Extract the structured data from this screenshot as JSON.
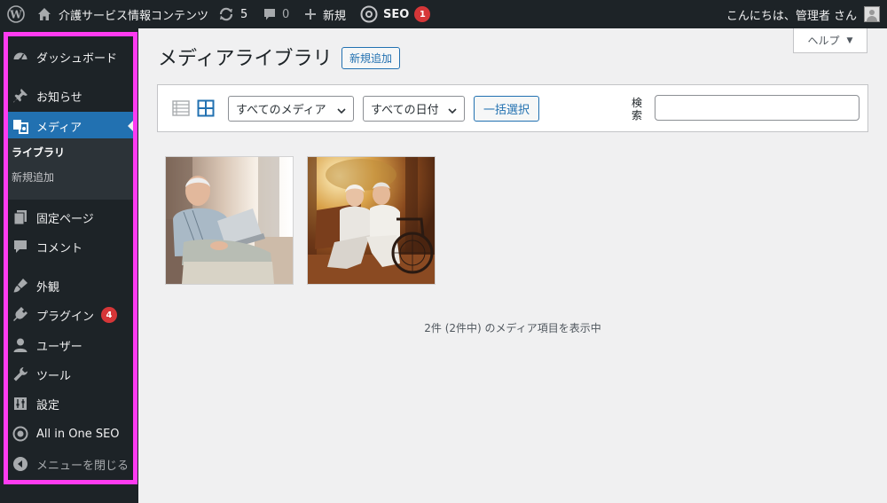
{
  "adminbar": {
    "site_name": "介護サービス情報コンテンツ",
    "updates_count": "5",
    "comments_count": "0",
    "new_label": "新規",
    "seo_label": "SEO",
    "seo_badge": "1",
    "greeting": "こんにちは、管理者 さん"
  },
  "sidebar": {
    "items": [
      {
        "label": "ダッシュボード",
        "icon": "dashboard-icon"
      },
      {
        "label": "お知らせ",
        "icon": "pin-icon"
      },
      {
        "label": "メディア",
        "icon": "media-icon"
      },
      {
        "label": "固定ページ",
        "icon": "page-icon"
      },
      {
        "label": "コメント",
        "icon": "comment-icon"
      },
      {
        "label": "外観",
        "icon": "appearance-icon"
      },
      {
        "label": "プラグイン",
        "icon": "plugin-icon",
        "badge": "4"
      },
      {
        "label": "ユーザー",
        "icon": "user-icon"
      },
      {
        "label": "ツール",
        "icon": "wrench-icon"
      },
      {
        "label": "設定",
        "icon": "settings-icon"
      },
      {
        "label": "All in One SEO",
        "icon": "aioseo-icon"
      },
      {
        "label": "メニューを閉じる",
        "icon": "collapse-icon"
      }
    ],
    "submenu": [
      {
        "label": "ライブラリ",
        "active": true
      },
      {
        "label": "新規追加",
        "active": false
      }
    ]
  },
  "main": {
    "help_tab": "ヘルプ",
    "title": "メディアライブラリ",
    "add_new": "新規追加",
    "filters": {
      "media_type": "すべてのメディア",
      "date": "すべての日付",
      "bulk_select": "一括選択",
      "search_label": "検索"
    },
    "result_count": "2件 (2件中) のメディア項目を表示中"
  },
  "colors": {
    "adminbar_bg": "#1d2327",
    "accent": "#2271b1",
    "badge": "#d63638",
    "sidebar_highlight_border": "#ff3bf0"
  }
}
